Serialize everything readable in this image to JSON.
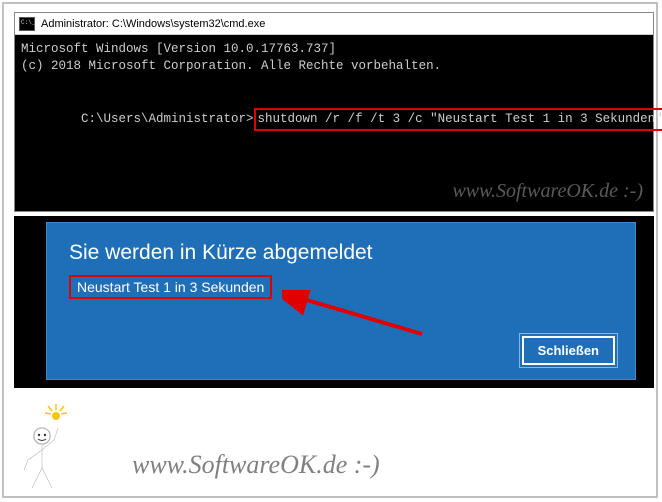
{
  "cmd": {
    "title": "Administrator: C:\\Windows\\system32\\cmd.exe",
    "line1": "Microsoft Windows [Version 10.0.17763.737]",
    "line2": "(c) 2018 Microsoft Corporation. Alle Rechte vorbehalten.",
    "prompt": "C:\\Users\\Administrator>",
    "command": "shutdown /r /f /t 3 /c \"Neustart Test 1 in 3 Sekunden\""
  },
  "watermark": {
    "text": "www.SoftwareOK.de :-)"
  },
  "dialog": {
    "title": "Sie werden in Kürze abgemeldet",
    "message": "Neustart Test 1 in 3 Sekunden",
    "close_label": "Schließen"
  }
}
